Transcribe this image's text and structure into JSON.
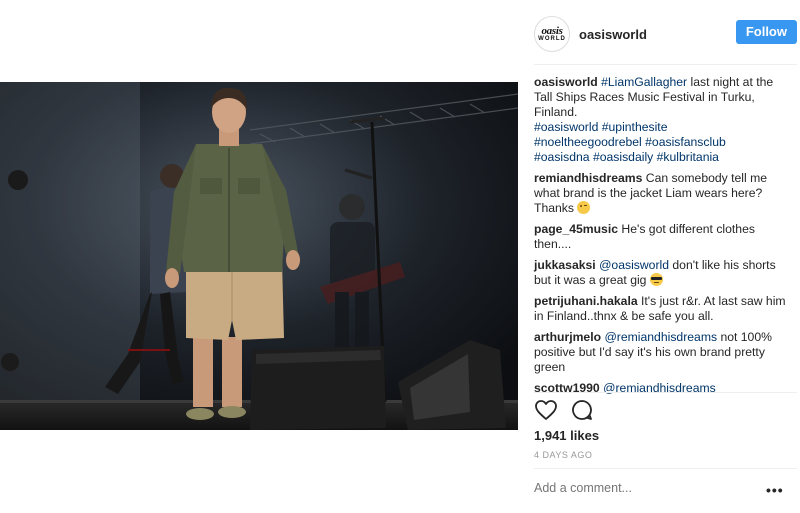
{
  "header": {
    "avatar_line1": "oasis",
    "avatar_line2": "WORLD",
    "username": "oasisworld",
    "follow_label": "Follow"
  },
  "caption": {
    "user": "oasisworld",
    "mention": "#LiamGallagher",
    "text": " last night at the Tall Ships Races Music Festival in Turku, Finland.",
    "hashtags_line1": "#oasisworld #upinthesite",
    "hashtags_line2": "#noeltheegoodrebel #oasisfansclub",
    "hashtags_line3": "#oasisdna #oasisdaily #kulbritania"
  },
  "comments": [
    {
      "user": "remiandhisdreams",
      "mention": "",
      "text": "Can somebody tell me what brand is the jacket Liam wears here? Thanks ",
      "emoji": "wink-emoji"
    },
    {
      "user": "page_45music",
      "mention": "",
      "text": "He's got different clothes then....",
      "emoji": ""
    },
    {
      "user": "jukkasaksi",
      "mention": "@oasisworld",
      "text": " don't like his shorts but it was a great gig ",
      "emoji": "sunglasses-emoji"
    },
    {
      "user": "petrijuhani.hakala",
      "mention": "",
      "text": "It's just r&r. At last saw him in Finland..thnx & be safe you all.",
      "emoji": ""
    },
    {
      "user": "arthurjmelo",
      "mention": "@remiandhisdreams",
      "text": " not 100% positive but I'd say it's his own brand pretty green",
      "emoji": ""
    },
    {
      "user": "scottw1990",
      "mention": "@remiandhisdreams",
      "text": "",
      "emoji": ""
    }
  ],
  "actions": {
    "like_icon": "heart-icon",
    "comment_icon": "comment-bubble-icon"
  },
  "likes": "1,941 likes",
  "timestamp": "4 DAYS AGO",
  "add_comment": {
    "placeholder": "Add a comment..."
  },
  "more_label": "•••",
  "colors": {
    "follow_button": "#3897f0",
    "link": "#003569",
    "text": "#262626",
    "muted": "#999999"
  }
}
